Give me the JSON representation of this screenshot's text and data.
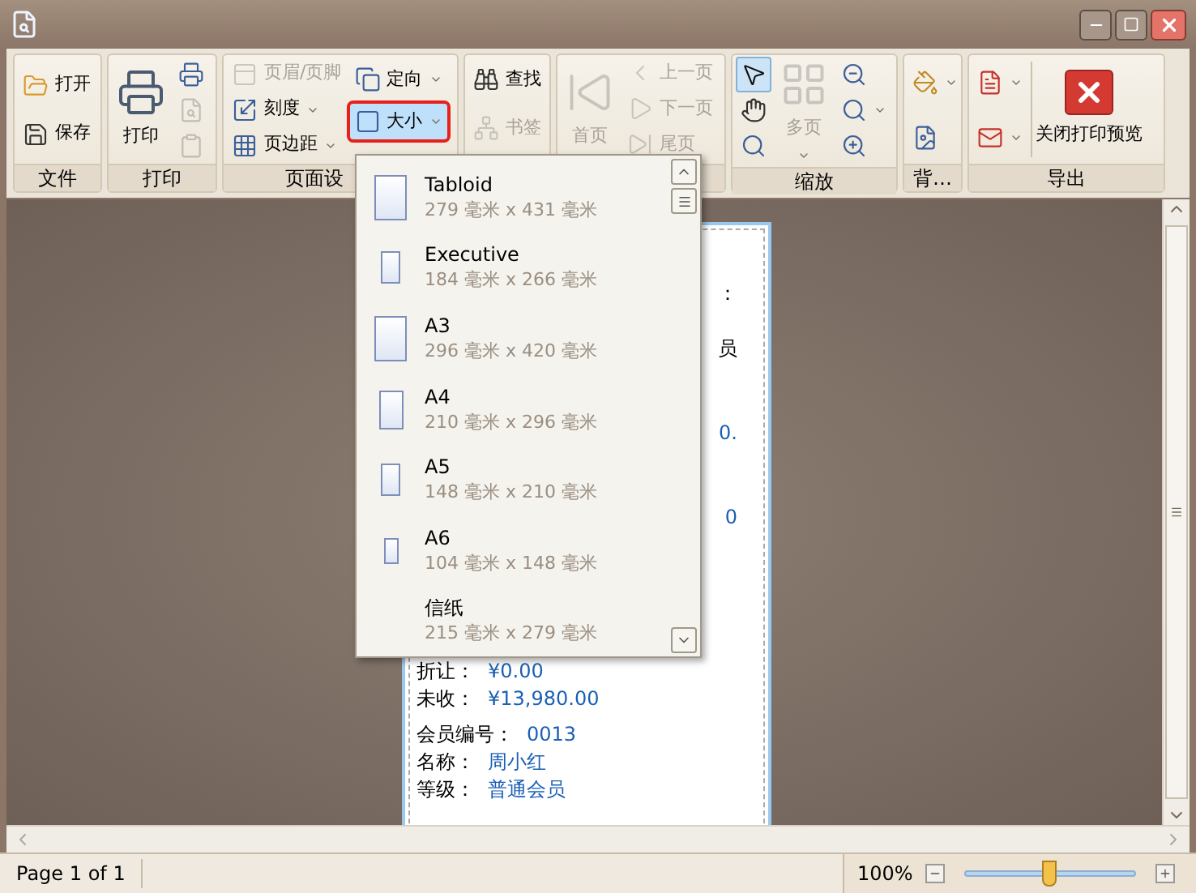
{
  "ribbon": {
    "groups": [
      {
        "label": "文件",
        "items": [
          {
            "label": "打开",
            "disabled": false
          },
          {
            "label": "保存",
            "disabled": false
          }
        ]
      },
      {
        "label": "打印",
        "items": [
          {
            "label": "打印",
            "disabled": false
          },
          {
            "disabled": false
          },
          {
            "disabled": true
          },
          {
            "disabled": true
          }
        ]
      },
      {
        "label": "页面设",
        "items": [
          {
            "label": "页眉/页脚",
            "disabled": true
          },
          {
            "label": "刻度",
            "disabled": false,
            "dropdown": true
          },
          {
            "label": "页边距",
            "disabled": false,
            "dropdown": true
          },
          {
            "label": "定向",
            "disabled": false,
            "dropdown": true
          },
          {
            "label": "大小",
            "disabled": false,
            "dropdown": true,
            "highlighted": true
          }
        ]
      },
      {
        "items": [
          {
            "label": "查找",
            "disabled": false
          },
          {
            "label": "书签",
            "disabled": true
          }
        ]
      },
      {
        "items": [
          {
            "label": "首页",
            "disabled": true
          },
          {
            "label": "上一页",
            "disabled": true
          },
          {
            "label": "下一页",
            "disabled": true
          },
          {
            "label": "尾页",
            "disabled": true
          }
        ]
      },
      {
        "label": "缩放",
        "items": [
          {
            "selected": true,
            "disabled": false
          },
          {
            "selected": false,
            "disabled": false
          },
          {
            "selected": false,
            "disabled": false
          },
          {
            "label": "多页",
            "disabled": true,
            "dropdown": true
          },
          {
            "disabled": false
          },
          {
            "disabled": false,
            "dropdown": true
          },
          {
            "disabled": false
          }
        ]
      },
      {
        "label": "背…",
        "items": [
          {
            "disabled": false,
            "dropdown": true
          },
          {
            "disabled": false
          }
        ]
      },
      {
        "label": "导出",
        "items": [
          {
            "disabled": false,
            "dropdown": true
          },
          {
            "disabled": false,
            "dropdown": true
          },
          {
            "label": "关闭打印预览",
            "disabled": false
          }
        ]
      }
    ]
  },
  "size_menu": {
    "items": [
      {
        "name": "Tabloid",
        "size": "279 毫米 x 431 毫米"
      },
      {
        "name": "Executive",
        "size": "184 毫米 x 266 毫米"
      },
      {
        "name": "A3",
        "size": "296 毫米 x 420 毫米"
      },
      {
        "name": "A4",
        "size": "210 毫米 x 296 毫米"
      },
      {
        "name": "A5",
        "size": "148 毫米 x 210 毫米"
      },
      {
        "name": "A6",
        "size": "104 毫米 x 148 毫米"
      },
      {
        "name": "信纸",
        "size": "215 毫米 x 279 毫米"
      }
    ]
  },
  "preview": {
    "fragments": [
      "：",
      "员",
      "0.",
      "0"
    ],
    "sections": [
      [
        {
          "label": "折让：",
          "value": "¥0.00"
        },
        {
          "label": "未收：",
          "value": "¥13,980.00"
        }
      ],
      [
        {
          "label": "会员编号：",
          "value": "0013"
        },
        {
          "label": "名称：",
          "value": "周小红"
        },
        {
          "label": "等级：",
          "value": "普通会员"
        }
      ]
    ]
  },
  "status_bar": {
    "page": "Page 1 of 1",
    "zoom": "100%",
    "zoom_slider": {
      "level": 0.49
    }
  }
}
